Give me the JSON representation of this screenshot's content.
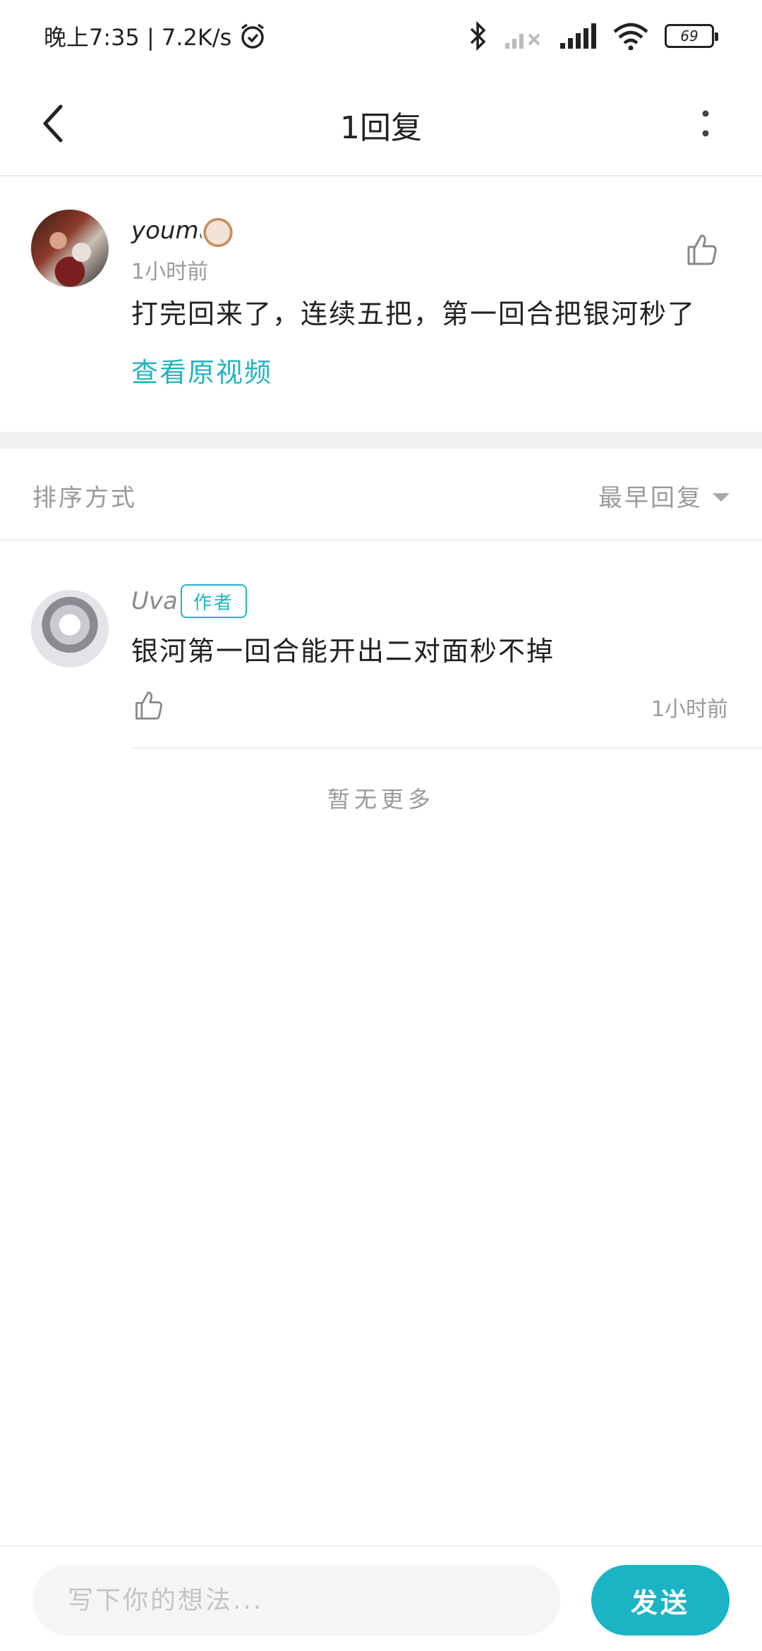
{
  "status_bar": {
    "time": "晚上7:35 | 7.2K/s",
    "battery": "69",
    "icons": [
      "alarm-icon",
      "bluetooth-icon",
      "signal-off-icon",
      "signal-icon",
      "wifi-icon",
      "battery-icon"
    ]
  },
  "header": {
    "title": "1回复",
    "back_icon": "chevron-left-icon",
    "more_icon": "more-vertical-icon"
  },
  "main_comment": {
    "username": "youmu",
    "time": "1小时前",
    "text": "打完回来了，连续五把，第一回合把银河秒了",
    "link": "查看原视频"
  },
  "sort": {
    "label": "排序方式",
    "selected": "最早回复"
  },
  "replies": [
    {
      "username": "Uva",
      "tag": "作者",
      "text": "银河第一回合能开出二对面秒不掉",
      "time": "1小时前"
    }
  ],
  "footer_note": "暂无更多",
  "input": {
    "placeholder": "写下你的想法..."
  },
  "send_label": "发送",
  "colors": {
    "accent": "#1ab4c5",
    "divider": "#ececec",
    "muted_text": "#9a9a9a"
  }
}
